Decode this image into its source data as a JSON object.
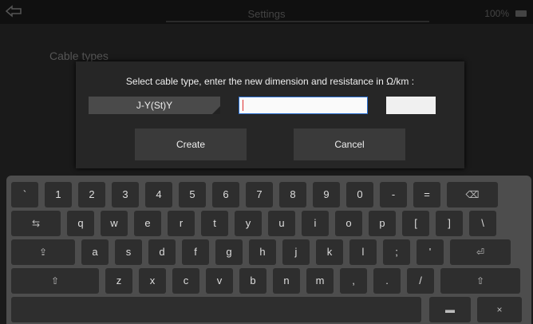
{
  "topbar": {
    "title": "Settings",
    "battery": "100%"
  },
  "section": {
    "label": "Cable types"
  },
  "dialog": {
    "prompt": "Select cable type, enter the new dimension and resistance in  Ω/km :",
    "cable_type": "J-Y(St)Y",
    "dimension_value": "",
    "resistance_value": "",
    "create_label": "Create",
    "cancel_label": "Cancel"
  },
  "keyboard": {
    "row1": [
      "`",
      "1",
      "2",
      "3",
      "4",
      "5",
      "6",
      "7",
      "8",
      "9",
      "0",
      "-",
      "=",
      "⌫"
    ],
    "row2": [
      "⇆",
      "q",
      "w",
      "e",
      "r",
      "t",
      "y",
      "u",
      "i",
      "o",
      "p",
      "[",
      "]",
      "\\"
    ],
    "row3": [
      "⇪",
      "a",
      "s",
      "d",
      "f",
      "g",
      "h",
      "j",
      "k",
      "l",
      ";",
      "'",
      "⏎"
    ],
    "row4": [
      "⇧",
      "z",
      "x",
      "c",
      "v",
      "b",
      "n",
      "m",
      ",",
      ".",
      "/",
      "⇧"
    ],
    "row5": [
      "",
      "▬",
      "×"
    ]
  },
  "colors": {
    "accent": "#2a6fd0",
    "caret": "#e03030"
  }
}
